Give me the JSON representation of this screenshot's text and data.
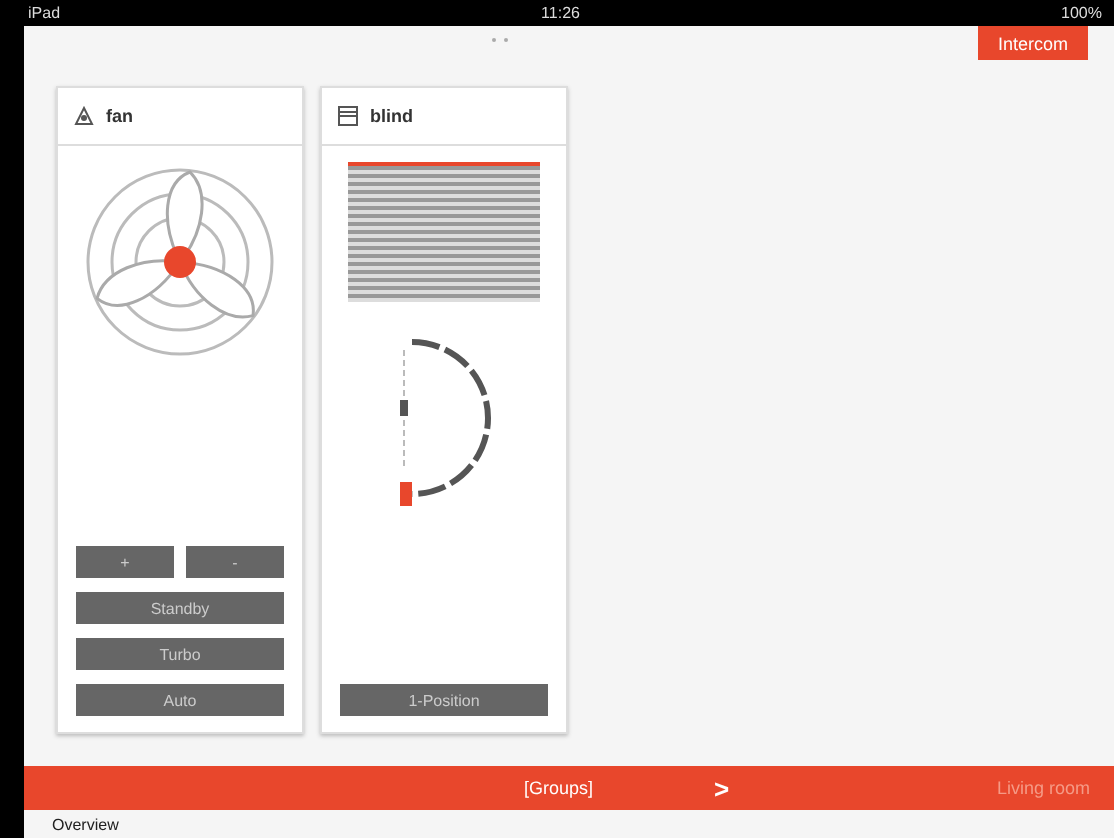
{
  "status_bar": {
    "device": "iPad",
    "time": "11:26",
    "battery": "100%"
  },
  "header": {
    "button": "Intercom"
  },
  "cards": [
    {
      "kind": "fan",
      "title": "fan",
      "buttons": [
        [
          "+",
          "-"
        ],
        [
          "Standby"
        ],
        [
          "Turbo"
        ],
        [
          "Auto"
        ]
      ]
    },
    {
      "kind": "blind",
      "title": "blind",
      "buttons": [
        [
          "1-Position"
        ]
      ]
    }
  ],
  "bottom_bar": {
    "group": "[Groups]",
    "arrow": ">",
    "room": "Living room"
  },
  "footer": {
    "title": "Overview"
  }
}
